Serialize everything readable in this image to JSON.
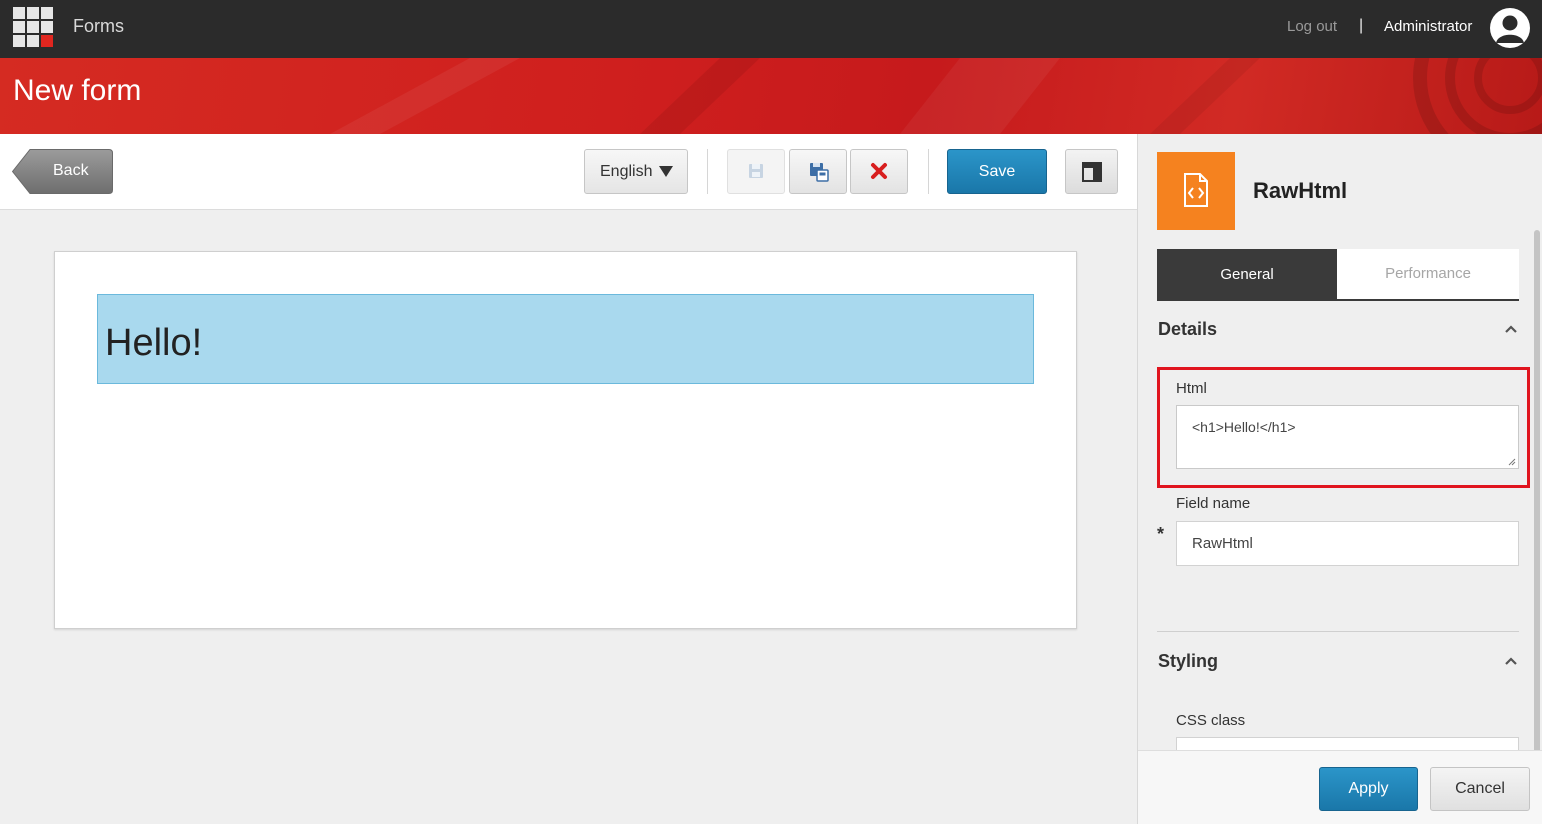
{
  "topbar": {
    "app_name": "Forms",
    "logout": "Log out",
    "separator": "|",
    "user": "Administrator",
    "app_icon": "app-grid-icon",
    "avatar_icon": "user-avatar-icon"
  },
  "header": {
    "title": "New form"
  },
  "toolbar": {
    "back_label": "Back",
    "language": "English",
    "save_label": "Save",
    "icons": [
      "save-icon",
      "save-as-icon",
      "delete-icon",
      "layout-panel-icon"
    ]
  },
  "canvas": {
    "raw_html_text": "Hello!"
  },
  "panel": {
    "element_title": "RawHtml",
    "element_icon": "code-file-icon",
    "tabs": [
      "General",
      "Performance"
    ],
    "details_title": "Details",
    "html_label": "Html",
    "html_value": "<h1>Hello!</h1>",
    "field_name_label": "Field name",
    "required_mark": "*",
    "field_name_value": "RawHtml",
    "styling_title": "Styling",
    "css_class_label": "CSS class",
    "apply_label": "Apply",
    "cancel_label": "Cancel"
  },
  "colors": {
    "topbar": "#2b2b2b",
    "header_red": "#cf1f1e",
    "primary_blue": "#1f86bb",
    "element_orange": "#f5821f",
    "highlight_red": "#e0141e",
    "selection_blue": "#a9d9ee"
  }
}
